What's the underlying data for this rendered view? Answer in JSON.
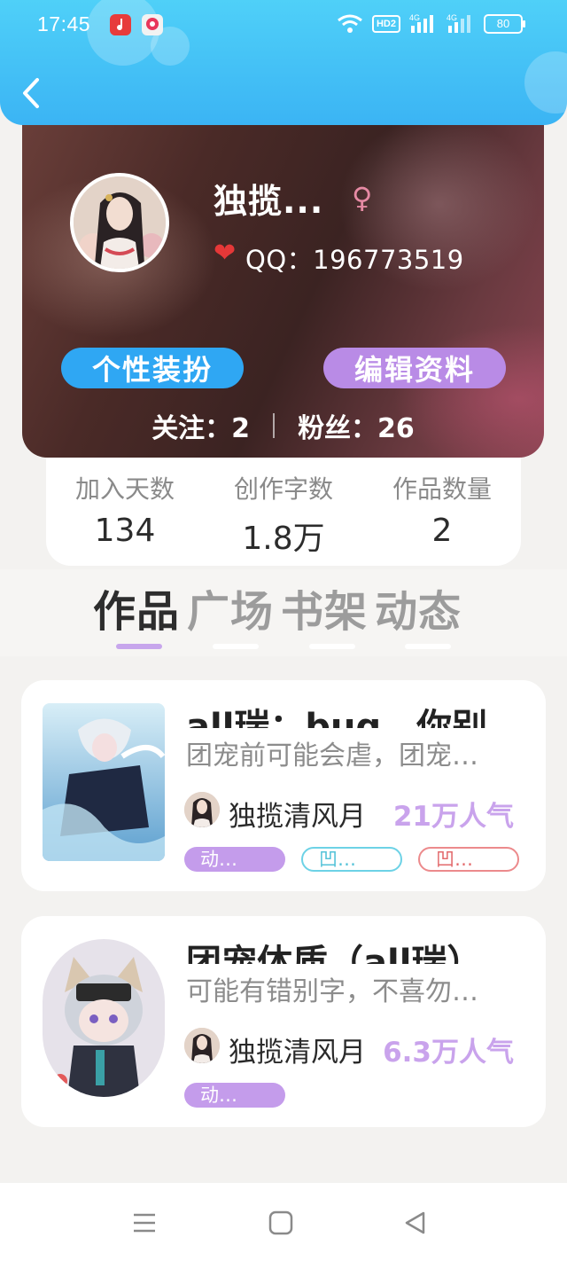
{
  "status_bar": {
    "time": "17:45",
    "hd_label": "HD2",
    "sig1_label": "4G",
    "sig2_label": "4G",
    "battery": "80"
  },
  "header": {
    "back_icon": "chevron-left-icon"
  },
  "profile": {
    "username": "独揽...",
    "gender_symbol": "♀",
    "heart": "❤",
    "qq": "QQ：196773519",
    "btn_decorate": "个性装扮",
    "btn_edit": "编辑资料",
    "following": "关注：2",
    "fans": "粉丝：26"
  },
  "stats": [
    {
      "label": "加入天数",
      "value": "134"
    },
    {
      "label": "创作字数",
      "value": "1.8万"
    },
    {
      "label": "作品数量",
      "value": "2"
    }
  ],
  "tabs": [
    "作品",
    "广场",
    "书架",
    "动态"
  ],
  "active_tab": 0,
  "books": [
    {
      "title": "all瑞：bug…你别",
      "desc": "团宠前可能会虐，团宠…",
      "author": "独揽清风月",
      "popularity": "21万人气",
      "tags": [
        "动…",
        "凹…",
        "凹…"
      ]
    },
    {
      "title": "团宠体质（all瑞）",
      "desc": "可能有错别字，不喜勿…",
      "author": "独揽清风月",
      "popularity": "6.3万人气",
      "tags": [
        "动…"
      ]
    }
  ],
  "colors": {
    "header_blue": "#3bb4f4",
    "accent_purple": "#c49ceb",
    "btn_blue": "#2fa7f3",
    "btn_purple": "#b98be6"
  }
}
